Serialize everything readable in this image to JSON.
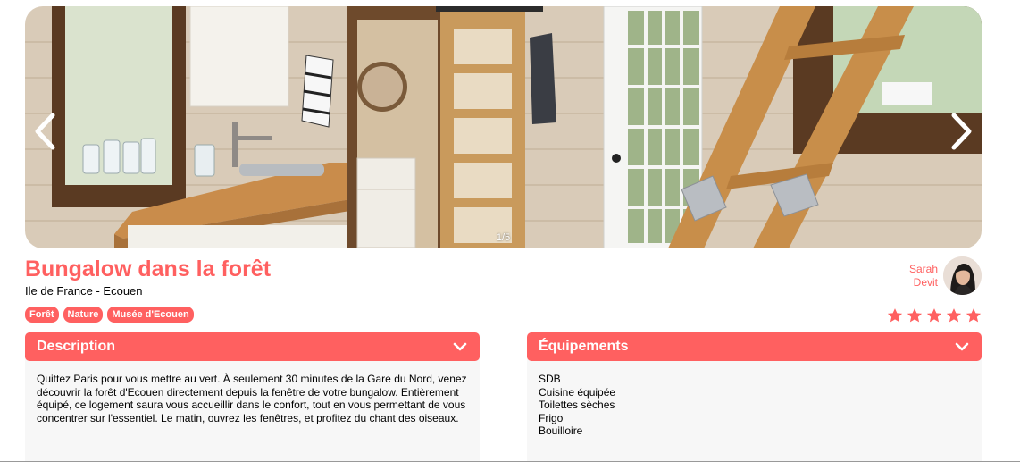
{
  "gallery": {
    "counter": "1/5",
    "prev_icon": "chevron-left-icon",
    "next_icon": "chevron-right-icon"
  },
  "listing": {
    "title": "Bungalow dans la forêt",
    "location": "Ile de France - Ecouen",
    "tags": [
      "Forêt",
      "Nature",
      "Musée d'Ecouen"
    ],
    "host": {
      "first_name": "Sarah",
      "last_name": "Devit"
    },
    "rating": 5,
    "rating_max": 5
  },
  "description": {
    "title": "Description",
    "text": "Quittez Paris pour vous mettre au vert. À seulement 30 minutes de la Gare du Nord, venez découvrir la forêt d'Ecouen directement depuis la fenêtre de votre bungalow. Entièrement équipé, ce logement saura vous accueillir dans le confort, tout en vous permettant de vous concentrer sur l'essentiel. Le matin, ouvrez les fenêtres, et profitez du chant des oiseaux."
  },
  "equipments": {
    "title": "Équipements",
    "items": [
      "SDB",
      "Cuisine équipée",
      "Toilettes sèches",
      "Frigo",
      "Bouilloire"
    ]
  },
  "colors": {
    "accent": "#FF6060",
    "panel_bg": "#F7F7F7"
  }
}
